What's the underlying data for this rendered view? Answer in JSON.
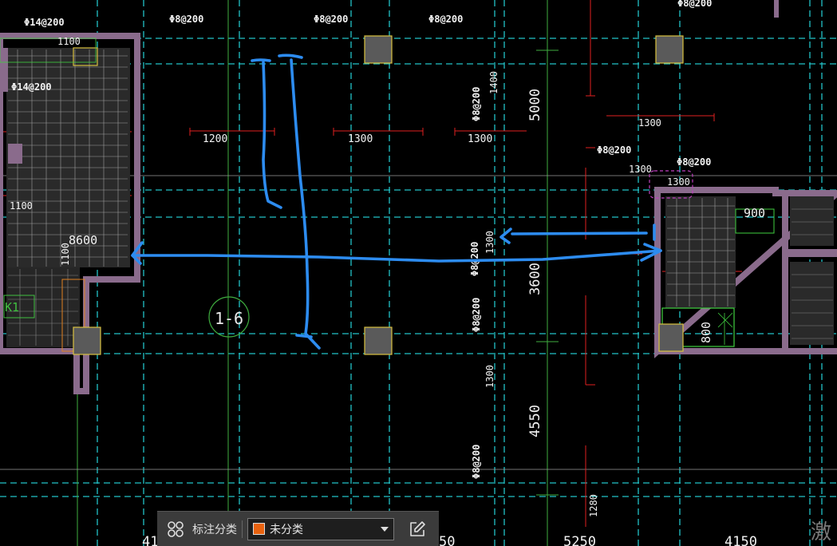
{
  "drawing": {
    "rebar_labels": [
      "Φ8@200",
      "Φ8@200",
      "Φ8@200",
      "Φ14@200",
      "Φ14@200",
      "Φ8@200",
      "Φ8@200",
      "Φ8@200",
      "Φ8@200",
      "Φ8@200",
      "Φ8@200",
      "Φ8@200"
    ],
    "dims": {
      "d1100a": "1100",
      "d1100b": "1100",
      "d1100c": "1100",
      "d8600": "8600",
      "d1200": "1200",
      "d1300a": "1300",
      "d1300b": "1300",
      "d1300c": "1300",
      "d1300d": "1300",
      "d1300e": "1300",
      "d1300f": "1300",
      "d1300g": "1300",
      "d1400": "1400",
      "d5000": "5000",
      "d3600": "3600",
      "d4550": "4550",
      "d1280": "1280",
      "d900": "900",
      "d800": "800",
      "d5250": "5250",
      "d4150": "4150",
      "d41": "41",
      "d50": "50",
      "k1": "K1",
      "marker": "1-6",
      "watermark": "激"
    }
  },
  "toolbar": {
    "label": "标注分类",
    "select_value": "未分类",
    "swatch_color": "#e8620f"
  }
}
